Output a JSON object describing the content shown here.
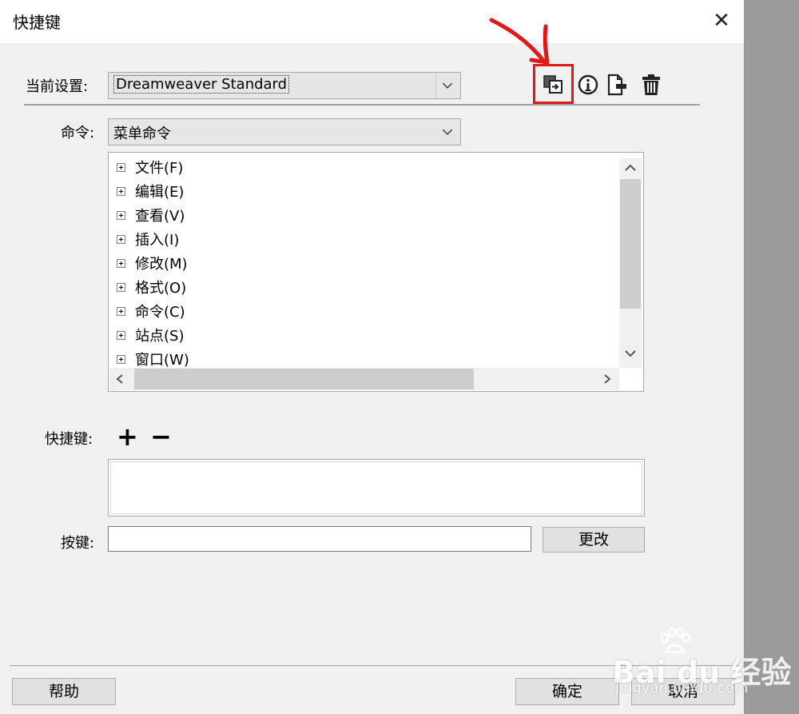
{
  "window": {
    "title": "快捷键",
    "close_glyph": "✕"
  },
  "current_set": {
    "label": "当前设置:",
    "value": "Dreamweaver Standard"
  },
  "toolbar_icons": [
    "duplicate-set-icon",
    "info-icon",
    "export-set-icon",
    "delete-set-icon"
  ],
  "commands": {
    "label": "命令:",
    "value": "菜单命令"
  },
  "tree": {
    "items": [
      {
        "label": "文件(F)"
      },
      {
        "label": "编辑(E)"
      },
      {
        "label": "查看(V)"
      },
      {
        "label": "插入(I)"
      },
      {
        "label": "修改(M)"
      },
      {
        "label": "格式(O)"
      },
      {
        "label": "命令(C)"
      },
      {
        "label": "站点(S)"
      },
      {
        "label": "窗口(W)"
      }
    ]
  },
  "shortcuts": {
    "label": "快捷键:",
    "add_glyph": "+",
    "remove_glyph": "−"
  },
  "keypress": {
    "label": "按键:",
    "value": "",
    "change_button": "更改"
  },
  "footer": {
    "help_button": "帮助",
    "ok_button": "确定",
    "cancel_button": "取消"
  },
  "annotation": {
    "color": "#e01818"
  },
  "watermark": {
    "text": "Bai du 经验",
    "url": "jingyan.baidu.com"
  }
}
